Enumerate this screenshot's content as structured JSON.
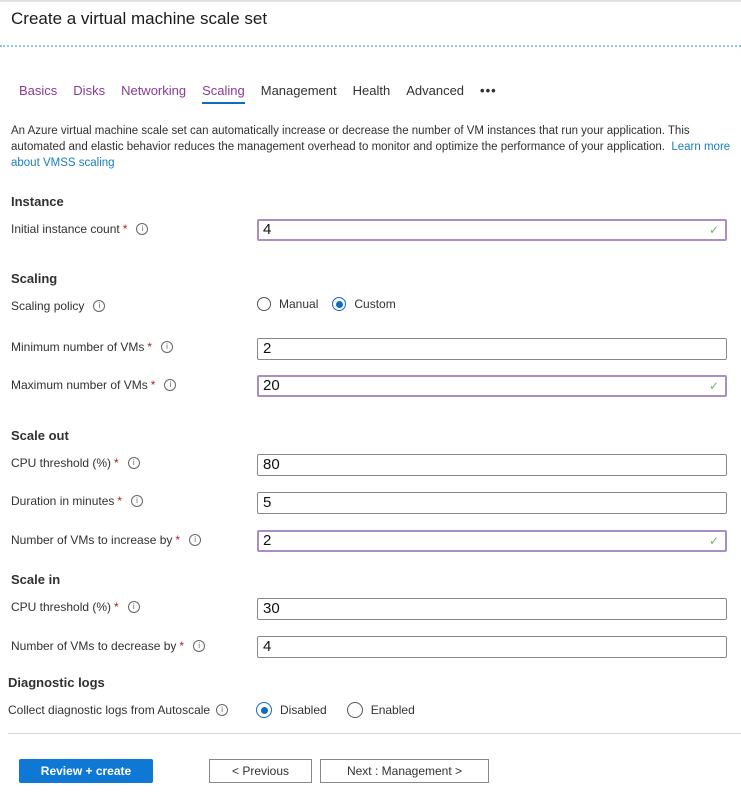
{
  "header": {
    "title": "Create a virtual machine scale set"
  },
  "tabs": [
    {
      "label": "Basics",
      "state": "visited"
    },
    {
      "label": "Disks",
      "state": "visited"
    },
    {
      "label": "Networking",
      "state": "visited"
    },
    {
      "label": "Scaling",
      "state": "active"
    },
    {
      "label": "Management",
      "state": "default"
    },
    {
      "label": "Health",
      "state": "default"
    },
    {
      "label": "Advanced",
      "state": "default"
    }
  ],
  "tabs_more": "•••",
  "description": {
    "text": "An Azure virtual machine scale set can automatically increase or decrease the number of VM instances that run your application. This automated and elastic behavior reduces the management overhead to monitor and optimize the performance of your application.",
    "link": "Learn more about VMSS scaling"
  },
  "sections": {
    "instance": "Instance",
    "scaling": "Scaling",
    "scale_out": "Scale out",
    "scale_in": "Scale in",
    "diagnostic_logs": "Diagnostic logs"
  },
  "fields": {
    "initial_instance_count": {
      "label": "Initial instance count",
      "value": "4",
      "valid": true
    },
    "scaling_policy": {
      "label": "Scaling policy",
      "options": [
        "Manual",
        "Custom"
      ],
      "selected": "Custom"
    },
    "min_vms": {
      "label": "Minimum number of VMs",
      "value": "2"
    },
    "max_vms": {
      "label": "Maximum number of VMs",
      "value": "20",
      "valid": true
    },
    "scale_out_cpu": {
      "label": "CPU threshold (%)",
      "value": "80"
    },
    "scale_out_duration": {
      "label": "Duration in minutes",
      "value": "5"
    },
    "scale_out_increase": {
      "label": "Number of VMs to increase by",
      "value": "2",
      "valid": true
    },
    "scale_in_cpu": {
      "label": "CPU threshold (%)",
      "value": "30"
    },
    "scale_in_decrease": {
      "label": "Number of VMs to decrease by",
      "value": "4"
    },
    "diagnostic": {
      "label": "Collect diagnostic logs from Autoscale",
      "options": [
        "Disabled",
        "Enabled"
      ],
      "selected": "Disabled"
    }
  },
  "required_mark": "*",
  "info_glyph": "i",
  "check_glyph": "✓",
  "buttons": {
    "review_create": "Review + create",
    "previous": "< Previous",
    "next": "Next : Management >"
  },
  "colors": {
    "accent": "#0f78d4",
    "visited_tab": "#8b3a95",
    "link": "#1a7fbf",
    "valid_border": "#a98dc3",
    "required": "#a4262c"
  }
}
